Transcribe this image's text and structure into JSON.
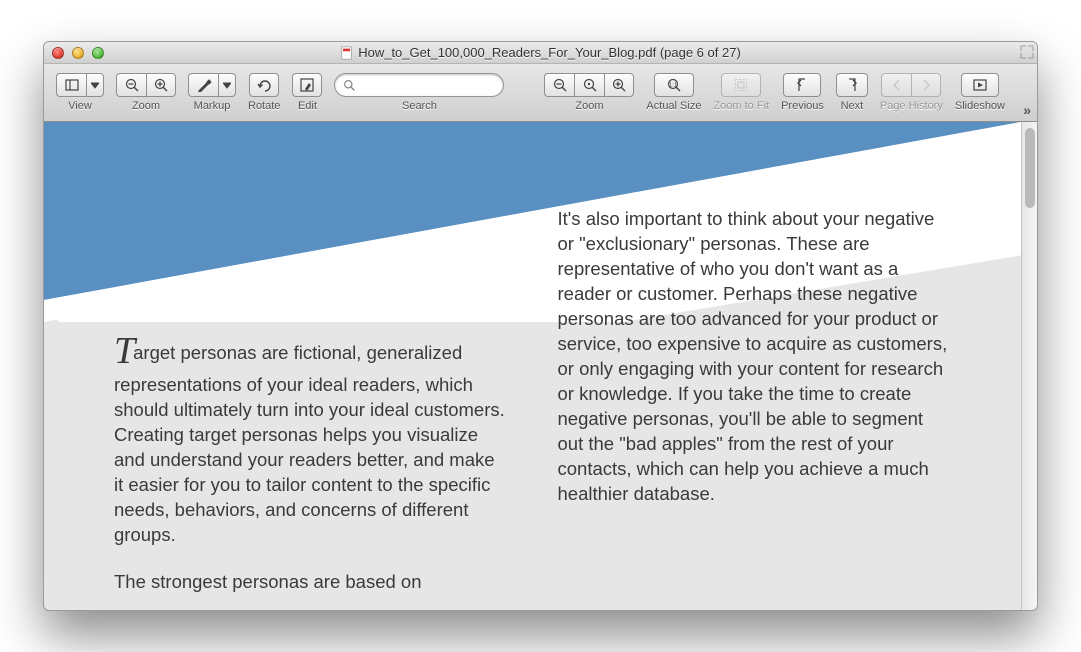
{
  "window": {
    "title": "How_to_Get_100,000_Readers_For_Your_Blog.pdf (page 6 of 27)"
  },
  "toolbar": {
    "view": "View",
    "zoom1": "Zoom",
    "markup": "Markup",
    "rotate": "Rotate",
    "edit": "Edit",
    "search": "Search",
    "search_placeholder": "",
    "zoom2": "Zoom",
    "actual": "Actual Size",
    "fit": "Zoom to Fit",
    "previous": "Previous",
    "next": "Next",
    "history": "Page History",
    "slideshow": "Slideshow"
  },
  "document": {
    "dropcap": "T",
    "left_p1": "arget personas are fictional, generalized representations of your ideal readers, which should ultimately turn into your ideal customers. Creating target personas helps you visualize and understand your readers better, and make it easier for you to tailor content to the specific needs, behaviors, and concerns of different groups.",
    "left_p2": "The strongest personas are based on",
    "right_p1": "It's also important to think about your negative or \"exclusionary\" personas. These are representative of who you don't want as a reader or customer. Perhaps these negative personas are too advanced for your product or service, too expensive to acquire as customers, or only engaging with your content for research or knowledge. If you take the time to create negative personas, you'll be able to segment out the \"bad apples\" from the rest of your contacts, which can help you achieve a much healthier database."
  }
}
